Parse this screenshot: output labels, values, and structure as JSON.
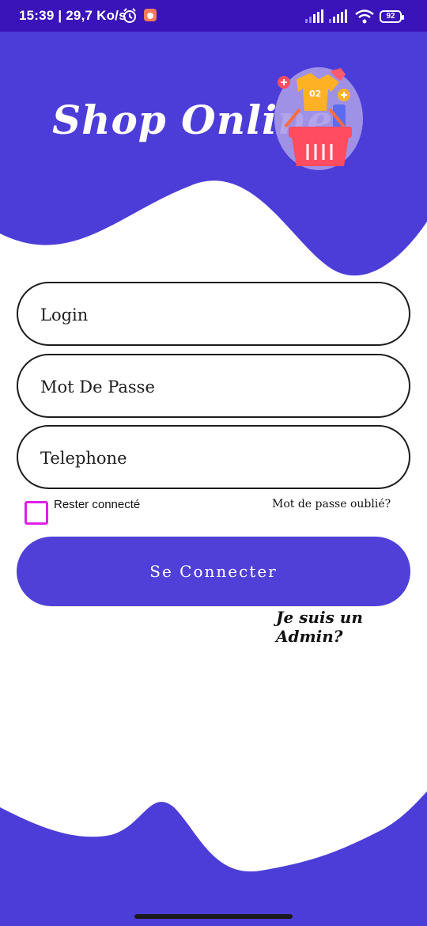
{
  "status_bar": {
    "time_speed": "15:39 | 29,7 Ko/s",
    "battery": "92",
    "icons": [
      "alarm-icon",
      "app-notification-icon",
      "signal-icon",
      "signal-icon",
      "wifi-icon",
      "battery-icon"
    ]
  },
  "header": {
    "brand": "Shop Online",
    "logo_icon": "shopping-basket-icon",
    "accent_color": "#4d3dd8"
  },
  "form": {
    "login_placeholder": "Login",
    "password_placeholder": "Mot De Passe",
    "phone_placeholder": "Telephone",
    "remember_label": "Rester connecté",
    "remember_checked": false,
    "forgot_label": "Mot de passe oublié?",
    "submit_label": "Se Connecter",
    "admin_link": "Je suis un Admin?"
  }
}
